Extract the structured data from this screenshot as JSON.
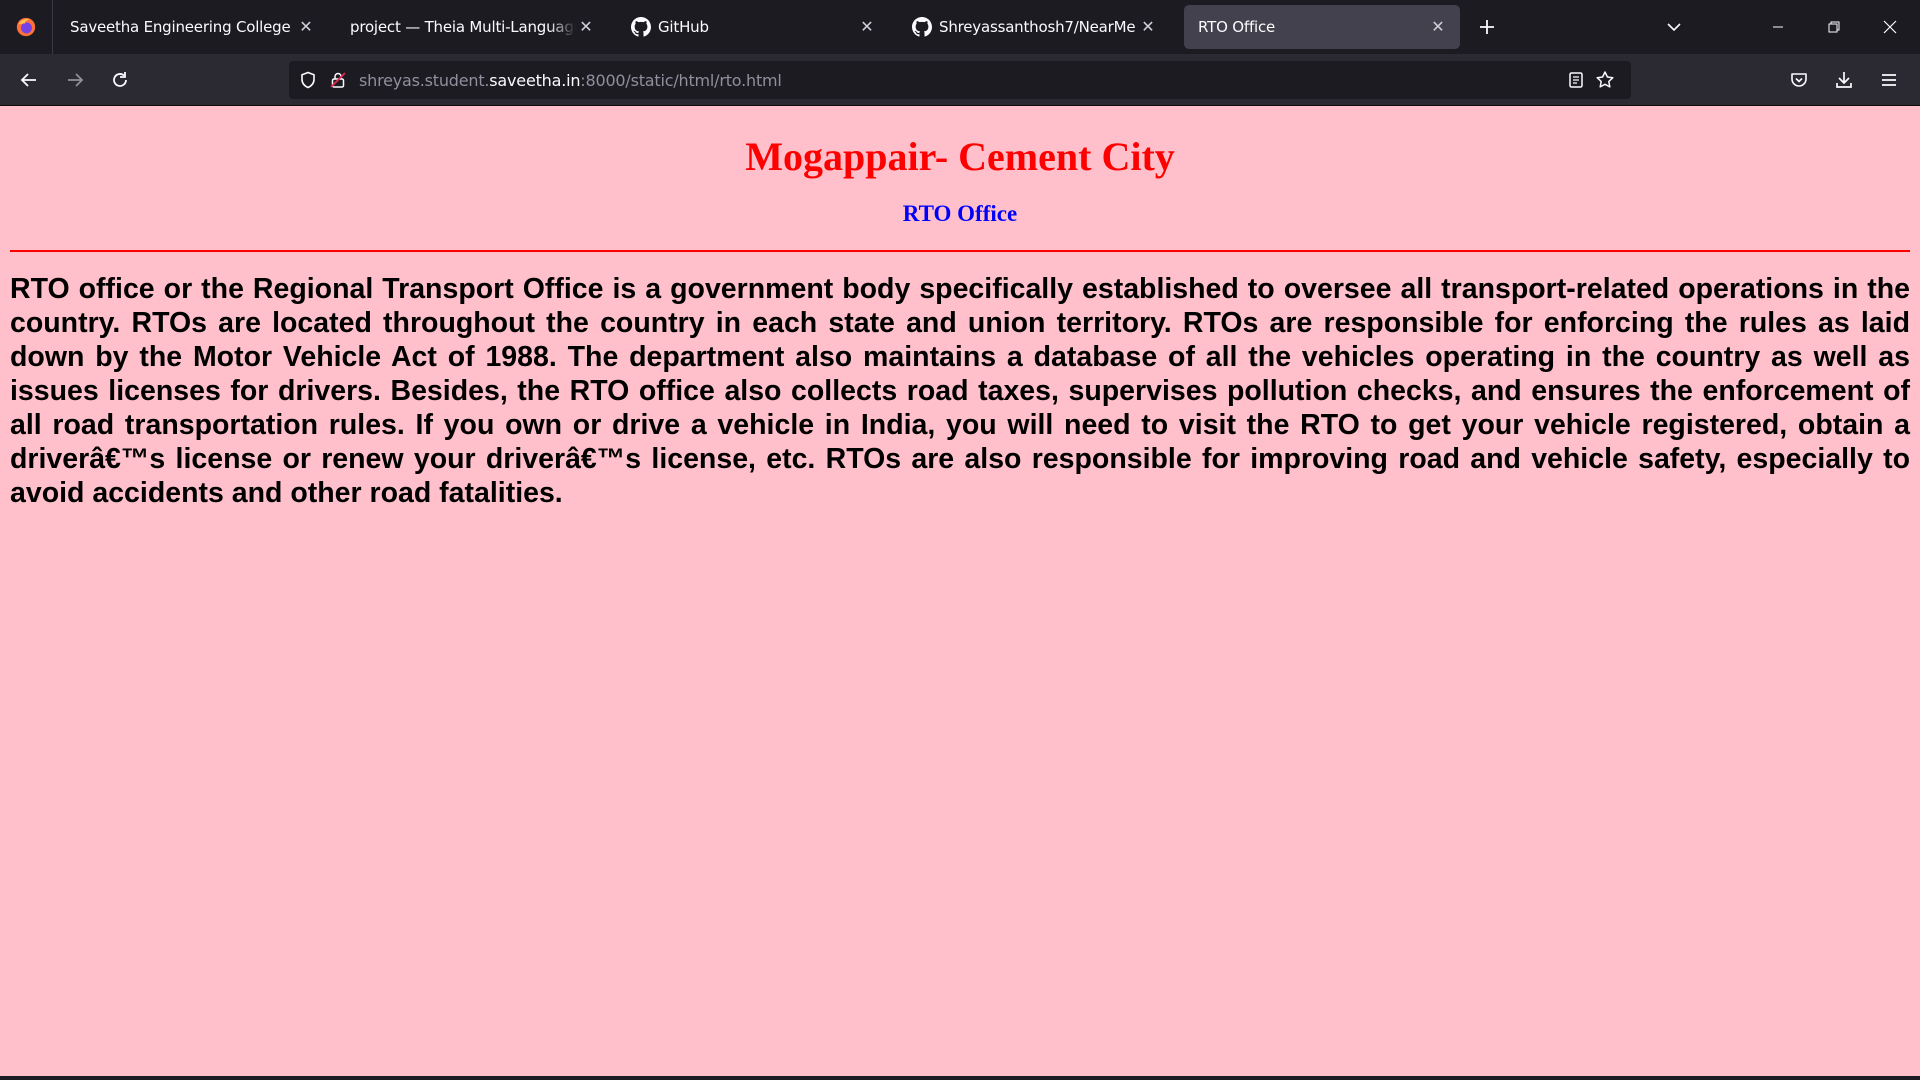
{
  "browser": {
    "tabs": [
      {
        "title": "Saveetha Engineering College",
        "icon": "none",
        "active": false
      },
      {
        "title": "project — Theia Multi-Language Explorer",
        "icon": "none",
        "active": false
      },
      {
        "title": "GitHub",
        "icon": "github-icon",
        "active": false
      },
      {
        "title": "Shreyassanthosh7/NearMe",
        "icon": "github-icon",
        "active": false
      },
      {
        "title": "RTO Office",
        "icon": "none",
        "active": true
      }
    ],
    "url": {
      "prefix": "shreyas.student.",
      "host": "saveetha.in",
      "suffix": ":8000/static/html/rto.html"
    }
  },
  "page": {
    "heading": "Mogappair- Cement City",
    "subheading": "RTO Office",
    "body": "RTO office or the Regional Transport Office is a government body specifically established to oversee all transport-related operations in the country. RTOs are located throughout the country in each state and union territory. RTOs are responsible for enforcing the rules as laid down by the Motor Vehicle Act of 1988. The department also maintains a database of all the vehicles operating in the country as well as issues licenses for drivers. Besides, the RTO office also collects road taxes, supervises pollution checks, and ensures the enforcement of all road transportation rules. If you own or drive a vehicle in India, you will need to visit the RTO to get your vehicle registered, obtain a driverâ€™s license or renew your driverâ€™s license, etc. RTOs are also responsible for improving road and vehicle safety, especially to avoid accidents and other road fatalities."
  },
  "colors": {
    "page_background": "#ffc0cb",
    "heading": "#ff0000",
    "subheading": "#0000ff",
    "rule": "#ff0000"
  }
}
